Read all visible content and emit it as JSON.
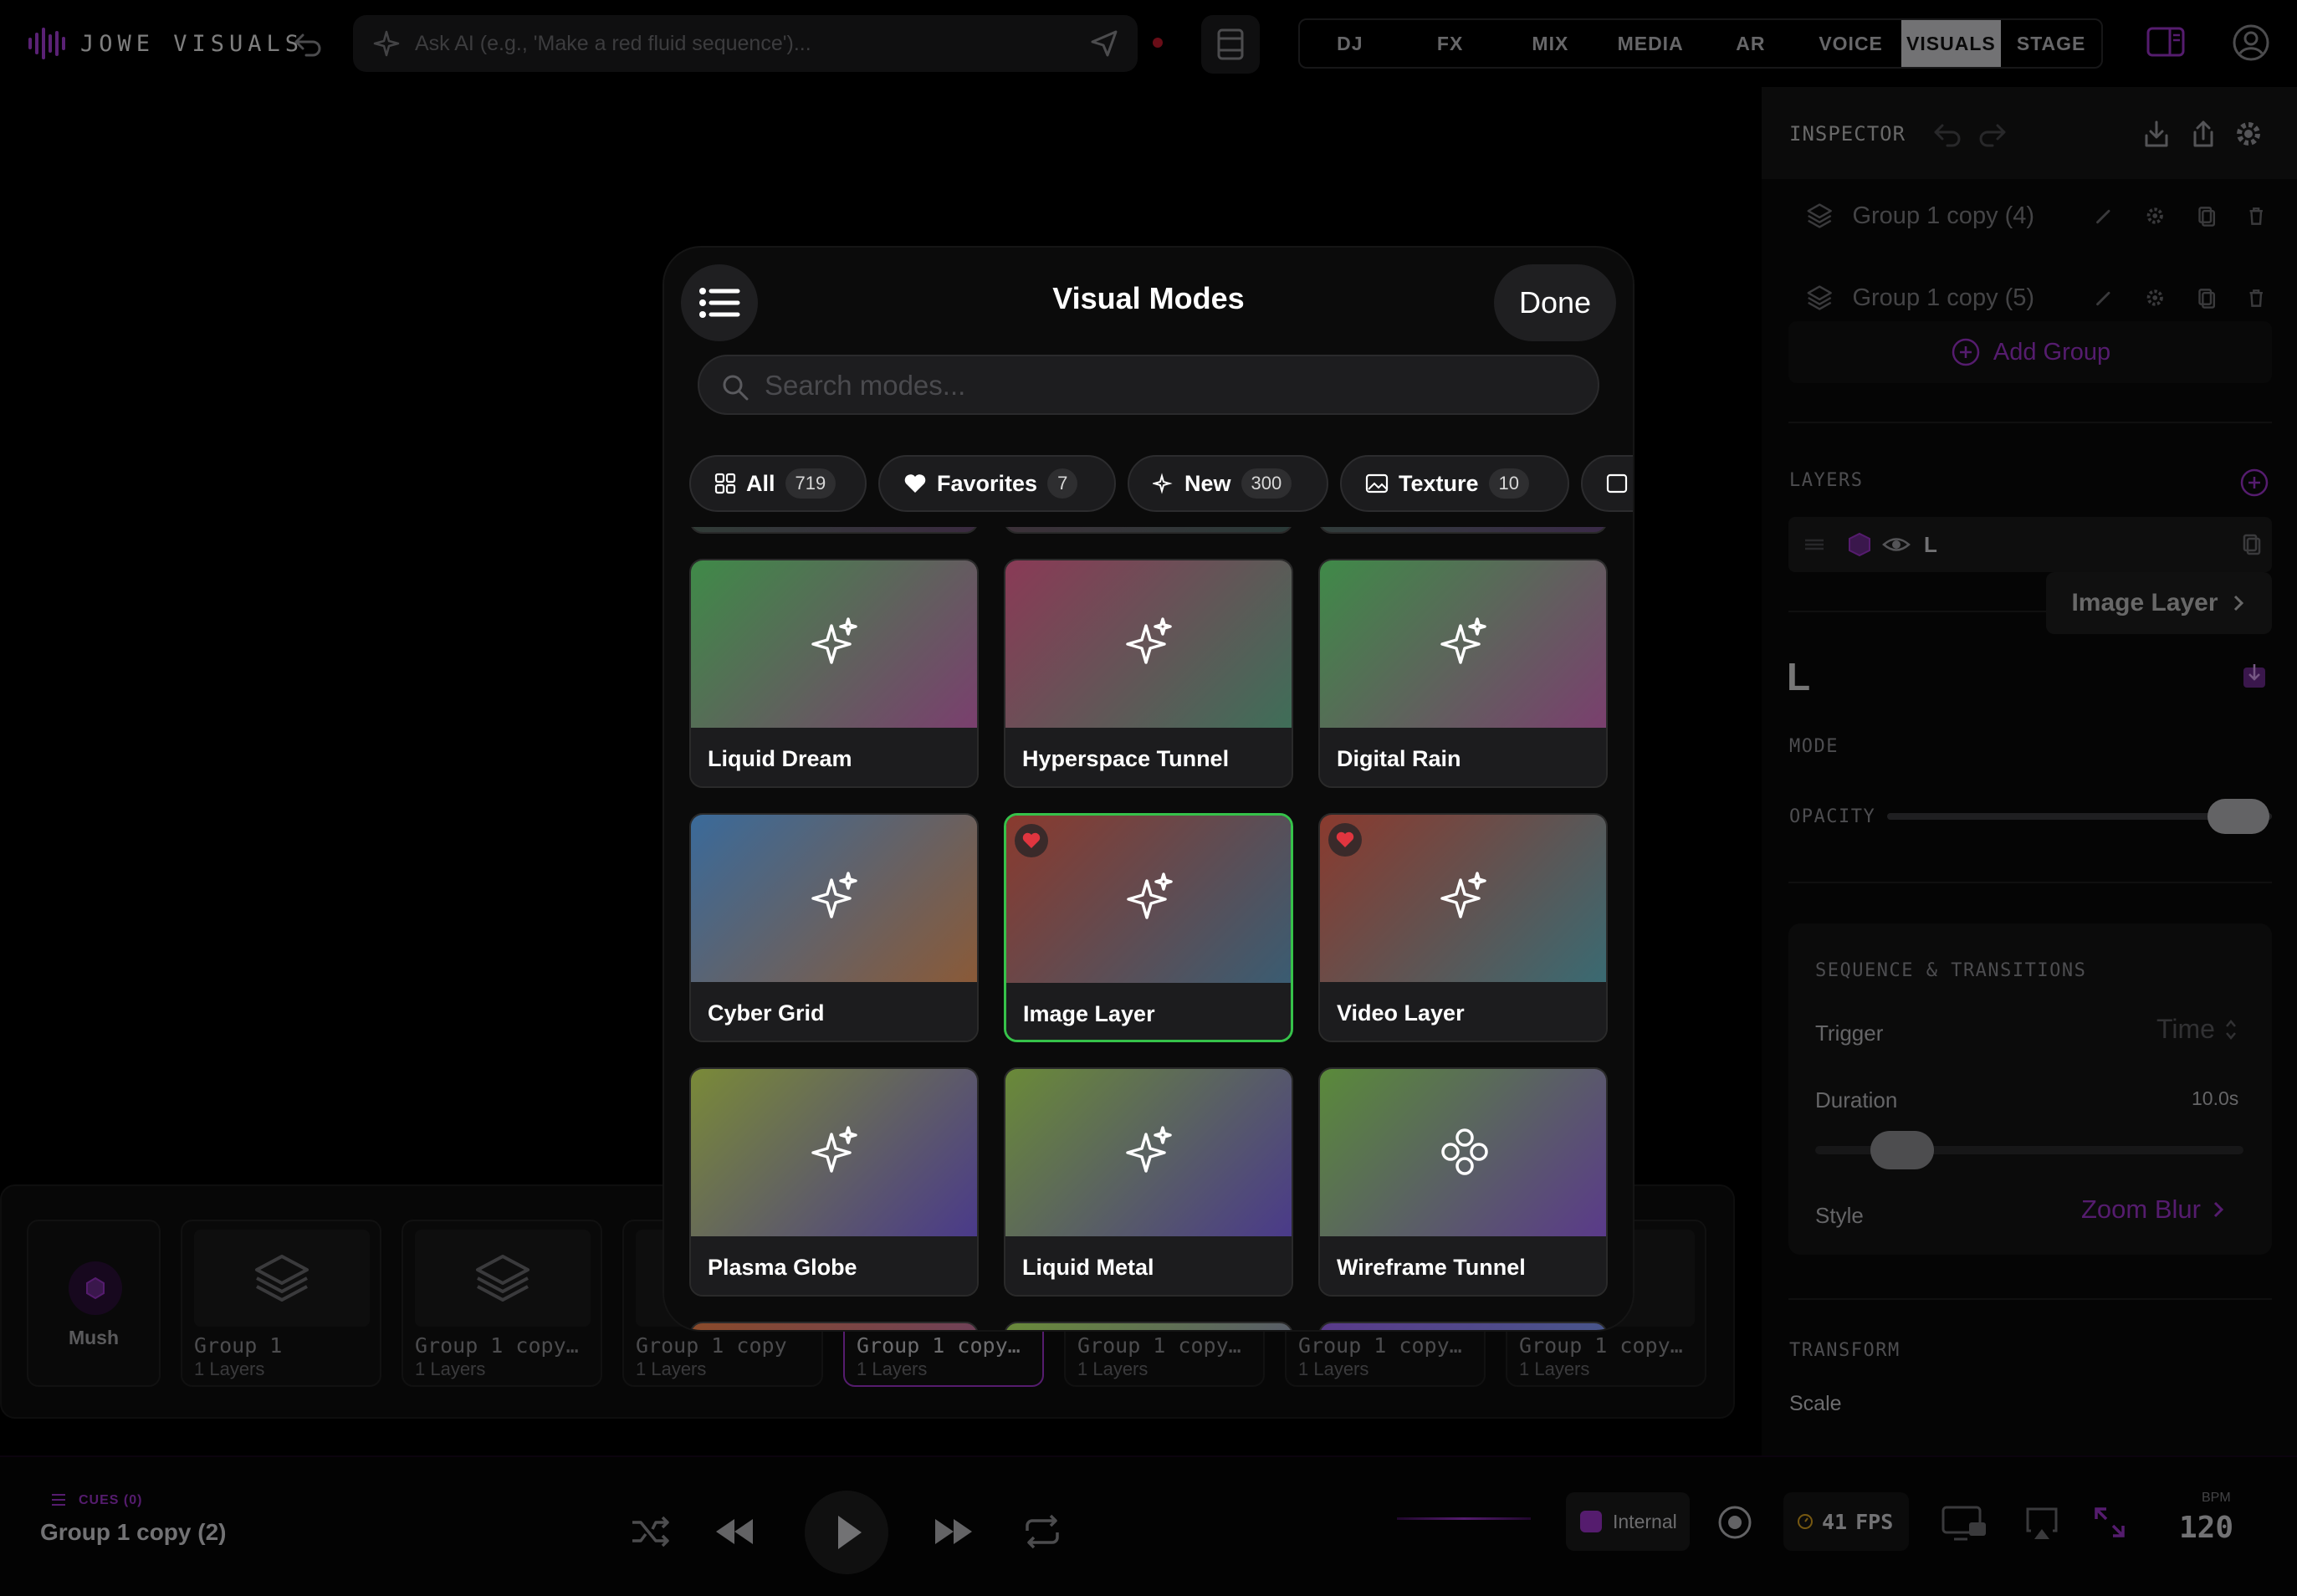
{
  "app": {
    "title": "JOWE VISUALS"
  },
  "ai_bar": {
    "placeholder": "Ask AI (e.g., 'Make a red fluid sequence')..."
  },
  "mode_tabs": [
    {
      "label": "DJ",
      "active": false
    },
    {
      "label": "FX",
      "active": false
    },
    {
      "label": "MIX",
      "active": false
    },
    {
      "label": "MEDIA",
      "active": false
    },
    {
      "label": "AR",
      "active": false
    },
    {
      "label": "VOICE",
      "active": false
    },
    {
      "label": "VISUALS",
      "active": true
    },
    {
      "label": "STAGE",
      "active": false
    }
  ],
  "inspector": {
    "title": "INSPECTOR",
    "groups": [
      "Group 1 copy (4)",
      "Group 1 copy (5)"
    ],
    "add_group": "Add Group",
    "layers_label": "LAYERS",
    "layer_name": "L",
    "selected_layer": "L",
    "mode_label": "MODE",
    "mode_value": "Image Layer",
    "opacity_label": "OPACITY",
    "opacity_value": 1.0,
    "sequence": {
      "title": "SEQUENCE & TRANSITIONS",
      "trigger_label": "Trigger",
      "trigger_value": "Time",
      "duration_label": "Duration",
      "duration_value": "10.0s",
      "style_label": "Style",
      "style_value": "Zoom Blur"
    },
    "transform_label": "TRANSFORM",
    "scale_label": "Scale"
  },
  "cue_strip": {
    "first_card": "Mush",
    "cards": [
      {
        "name": "Group 1",
        "sub": "1 Layers",
        "active": false
      },
      {
        "name": "Group 1 copy…",
        "sub": "1 Layers",
        "active": false
      },
      {
        "name": "Group 1 copy",
        "sub": "1 Layers",
        "active": false
      },
      {
        "name": "Group 1 copy…",
        "sub": "1 Layers",
        "active": true
      },
      {
        "name": "Group 1 copy…",
        "sub": "1 Layers",
        "active": false
      },
      {
        "name": "Group 1 copy…",
        "sub": "1 Layers",
        "active": false
      },
      {
        "name": "Group 1 copy…",
        "sub": "1 Layers",
        "active": false
      }
    ]
  },
  "footer": {
    "cues_badge": "CUES (0)",
    "current_group": "Group 1 copy (2)",
    "clock_source": "Internal",
    "fps": "41",
    "fps_unit": "FPS",
    "bpm_label": "BPM",
    "bpm_value": "120"
  },
  "modal": {
    "title": "Visual Modes",
    "done_label": "Done",
    "search_placeholder": "Search modes...",
    "chips": [
      {
        "label": "All",
        "count": "719",
        "icon": "grid-icon"
      },
      {
        "label": "Favorites",
        "count": "7",
        "icon": "heart-icon"
      },
      {
        "label": "New",
        "count": "300",
        "icon": "sparkle-icon"
      },
      {
        "label": "Texture",
        "count": "10",
        "icon": "image-icon"
      }
    ],
    "cards": [
      {
        "name": "Liquid Dream",
        "colors": [
          "#3f8a48",
          "#7a3f6e"
        ],
        "icon": "sparkle-icon",
        "favorite": false,
        "selected": false
      },
      {
        "name": "Hyperspace Tunnel",
        "colors": [
          "#8a3a56",
          "#3f6e58"
        ],
        "icon": "sparkle-icon",
        "favorite": false,
        "selected": false
      },
      {
        "name": "Digital Rain",
        "colors": [
          "#3f8a48",
          "#7a3f6e"
        ],
        "icon": "sparkle-icon",
        "favorite": false,
        "selected": false
      },
      {
        "name": "Cyber Grid",
        "colors": [
          "#3a6a9a",
          "#8a5a38"
        ],
        "icon": "sparkle-icon",
        "favorite": false,
        "selected": false
      },
      {
        "name": "Image Layer",
        "colors": [
          "#8a3a2e",
          "#3a5c72"
        ],
        "icon": "sparkle-icon",
        "favorite": true,
        "selected": true
      },
      {
        "name": "Video Layer",
        "colors": [
          "#8a3a2e",
          "#3a6a72"
        ],
        "icon": "sparkle-icon",
        "favorite": true,
        "selected": false
      },
      {
        "name": "Plasma Globe",
        "colors": [
          "#7a8a38",
          "#4a3a8a"
        ],
        "icon": "sparkle-icon",
        "favorite": false,
        "selected": false
      },
      {
        "name": "Liquid Metal",
        "colors": [
          "#6a8a38",
          "#4a3a8a"
        ],
        "icon": "sparkle-icon",
        "favorite": false,
        "selected": false
      },
      {
        "name": "Wireframe Tunnel",
        "colors": [
          "#5a8a3a",
          "#5a3a8a"
        ],
        "icon": "nodes-icon",
        "favorite": false,
        "selected": false
      }
    ]
  },
  "colors": {
    "accent": "#9b33c9",
    "selected": "#36c24a",
    "favorite": "#e0353f"
  }
}
